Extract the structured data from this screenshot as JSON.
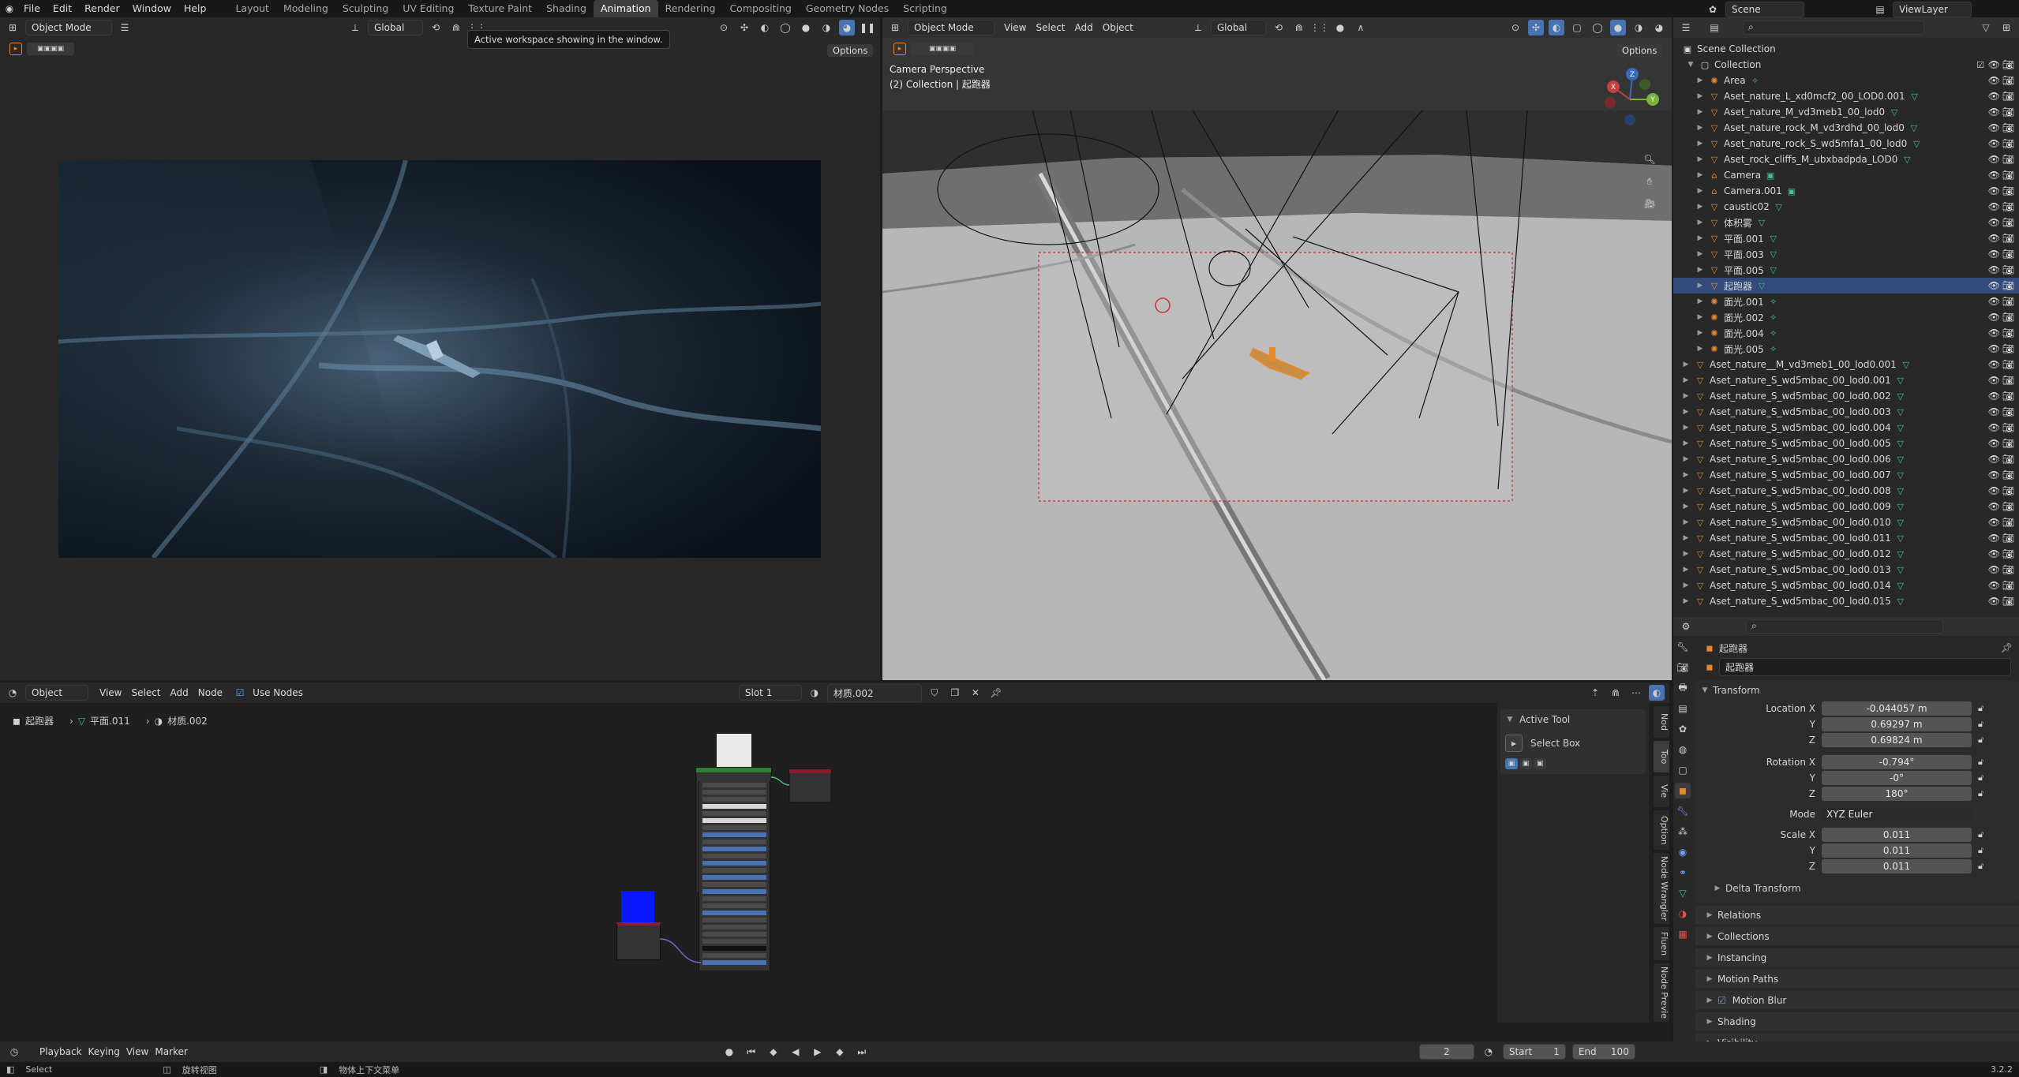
{
  "topbar": {
    "menus": [
      "File",
      "Edit",
      "Render",
      "Window",
      "Help"
    ],
    "workspaces": [
      "Layout",
      "Modeling",
      "Sculpting",
      "UV Editing",
      "Texture Paint",
      "Shading",
      "Animation",
      "Rendering",
      "Compositing",
      "Geometry Nodes",
      "Scripting"
    ],
    "active_workspace": "Animation",
    "scene_label": "Scene",
    "viewlayer_label": "ViewLayer"
  },
  "tooltip": "Active workspace showing in the window.",
  "left_viewport": {
    "mode": "Object Mode",
    "orientation": "Global",
    "options_label": "Options"
  },
  "right_viewport": {
    "mode": "Object Mode",
    "menus": [
      "View",
      "Select",
      "Add",
      "Object"
    ],
    "orientation": "Global",
    "options_label": "Options",
    "overlay_title": "Camera Perspective",
    "overlay_subtitle": "(2) Collection | 起跑器"
  },
  "outliner": {
    "root": "Scene Collection",
    "collection": "Collection",
    "items": [
      {
        "name": "Area",
        "type": "light"
      },
      {
        "name": "Aset_nature_L_xd0mcf2_00_LOD0.001",
        "type": "mesh"
      },
      {
        "name": "Aset_nature_M_vd3meb1_00_lod0",
        "type": "mesh"
      },
      {
        "name": "Aset_nature_rock_M_vd3rdhd_00_lod0",
        "type": "mesh"
      },
      {
        "name": "Aset_nature_rock_S_wd5mfa1_00_lod0",
        "type": "mesh"
      },
      {
        "name": "Aset_rock_cliffs_M_ubxbadpda_LOD0",
        "type": "mesh"
      },
      {
        "name": "Camera",
        "type": "camera"
      },
      {
        "name": "Camera.001",
        "type": "camera"
      },
      {
        "name": "caustic02",
        "type": "mesh"
      },
      {
        "name": "体积雾",
        "type": "mesh"
      },
      {
        "name": "平面.001",
        "type": "mesh"
      },
      {
        "name": "平面.003",
        "type": "mesh"
      },
      {
        "name": "平面.005",
        "type": "mesh"
      },
      {
        "name": "起跑器",
        "type": "mesh",
        "selected": true
      },
      {
        "name": "面光.001",
        "type": "light"
      },
      {
        "name": "面光.002",
        "type": "light"
      },
      {
        "name": "面光.004",
        "type": "light"
      },
      {
        "name": "面光.005",
        "type": "light"
      }
    ],
    "loose": [
      "Aset_nature__M_vd3meb1_00_lod0.001",
      "Aset_nature_S_wd5mbac_00_lod0.001",
      "Aset_nature_S_wd5mbac_00_lod0.002",
      "Aset_nature_S_wd5mbac_00_lod0.003",
      "Aset_nature_S_wd5mbac_00_lod0.004",
      "Aset_nature_S_wd5mbac_00_lod0.005",
      "Aset_nature_S_wd5mbac_00_lod0.006",
      "Aset_nature_S_wd5mbac_00_lod0.007",
      "Aset_nature_S_wd5mbac_00_lod0.008",
      "Aset_nature_S_wd5mbac_00_lod0.009",
      "Aset_nature_S_wd5mbac_00_lod0.010",
      "Aset_nature_S_wd5mbac_00_lod0.011",
      "Aset_nature_S_wd5mbac_00_lod0.012",
      "Aset_nature_S_wd5mbac_00_lod0.013",
      "Aset_nature_S_wd5mbac_00_lod0.014",
      "Aset_nature_S_wd5mbac_00_lod0.015"
    ]
  },
  "properties": {
    "object_name_top": "起跑器",
    "object_name": "起跑器",
    "transform_label": "Transform",
    "location_label": "Location X",
    "location": [
      "-0.044057 m",
      "0.69297 m",
      "0.69824 m"
    ],
    "rotation_label": "Rotation X",
    "rotation": [
      "-0.794°",
      "-0°",
      "180°"
    ],
    "mode_label": "Mode",
    "mode_value": "XYZ Euler",
    "scale_label": "Scale X",
    "scale": [
      "0.011",
      "0.011",
      "0.011"
    ],
    "axis_y": "Y",
    "axis_z": "Z",
    "delta": "Delta Transform",
    "sections": [
      "Relations",
      "Collections",
      "Instancing",
      "Motion Paths",
      "Motion Blur",
      "Shading",
      "Visibility"
    ]
  },
  "node_editor": {
    "mode": "Object",
    "menus": [
      "View",
      "Select",
      "Add",
      "Node"
    ],
    "use_nodes_label": "Use Nodes",
    "slot": "Slot 1",
    "material": "材质.002",
    "breadcrumb": [
      "起跑器",
      "平面.011",
      "材质.002"
    ],
    "active_tool_title": "Active Tool",
    "select_box": "Select Box",
    "side_tabs": [
      "Nod",
      "Too",
      "Vie",
      "Option",
      "Node Wrangler",
      "Fluen",
      "Node Previe"
    ]
  },
  "timeline": {
    "menus": [
      "Playback",
      "Keying",
      "View",
      "Marker"
    ],
    "current_frame": "2",
    "start_label": "Start",
    "start_value": "1",
    "end_label": "End",
    "end_value": "100"
  },
  "statusbar": {
    "select": "Select",
    "rotate": "旋转视图",
    "context": "物体上下文菜单",
    "version": "3.2.2"
  },
  "colors": {
    "selection": "#334b7a",
    "accent_orange": "#e6882e",
    "mesh_green": "#3fc48a",
    "header_bg": "#303030"
  }
}
